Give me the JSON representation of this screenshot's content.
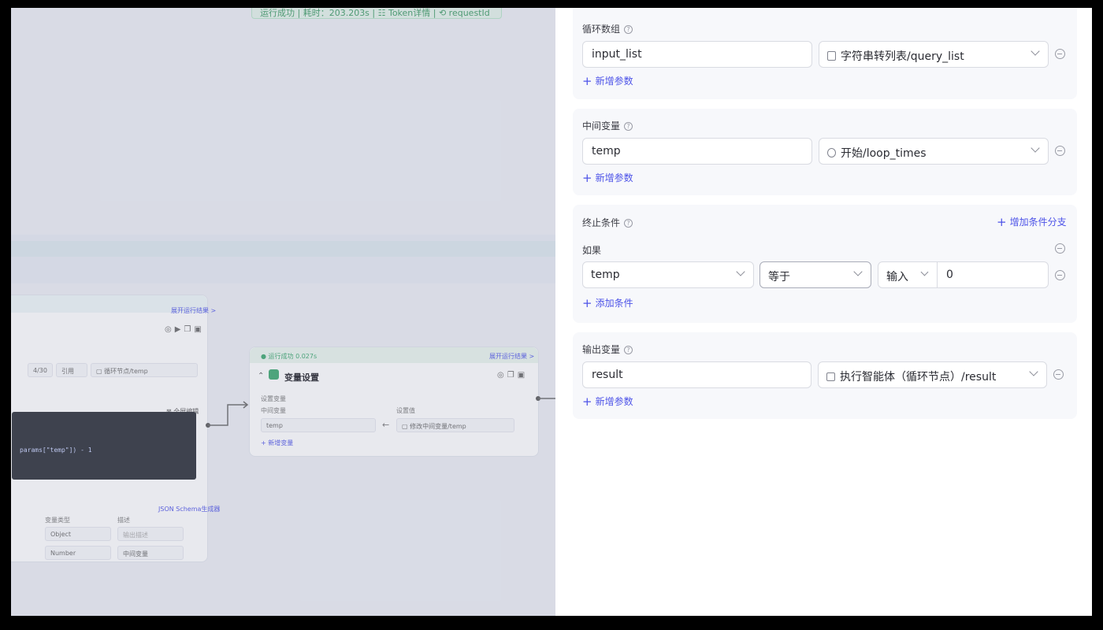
{
  "canvas": {
    "run_banner": "运行成功 | 耗时：203.203s | ☷ Token详情 | ⟲ requestId",
    "code_node": {
      "expand_result": "展开运行结果 >",
      "char_count": "4/30",
      "ref_mode": "引用",
      "ref_value": "循环节点/temp",
      "fullscreen_edit": "全屏编辑",
      "code_snippet": "params[\"temp\"]) - 1",
      "json_schema": "JSON Schema生成器",
      "col_type": "变量类型",
      "col_desc": "描述",
      "row1_type": "Object",
      "row1_desc": "输出描述",
      "row2_type": "Number",
      "row2_desc": "中间变量"
    },
    "var_node": {
      "status": "运行成功 0.027s",
      "expand_result": "展开运行结果 >",
      "title": "变量设置",
      "set_label": "设置变量",
      "mid_label": "中间变量",
      "value_label": "设置值",
      "mid_value": "temp",
      "set_value": "修改中间变量/temp",
      "add_var": "+ 新增变量"
    }
  },
  "panel": {
    "loop_array": {
      "label": "循环数组",
      "name": "input_list",
      "ref": "字符串转列表/query_list",
      "add": "新增参数"
    },
    "intermediate": {
      "label": "中间变量",
      "name": "temp",
      "ref": "开始/loop_times",
      "add": "新增参数"
    },
    "termination": {
      "label": "终止条件",
      "add_branch": "增加条件分支",
      "if_label": "如果",
      "left": "temp",
      "operator": "等于",
      "input_type": "输入",
      "value": "0",
      "add_condition": "添加条件"
    },
    "output": {
      "label": "输出变量",
      "name": "result",
      "ref": "执行智能体（循环节点）/result",
      "add": "新增参数"
    }
  },
  "colors": {
    "accent": "#4d53e8",
    "success": "#3aa76d"
  }
}
